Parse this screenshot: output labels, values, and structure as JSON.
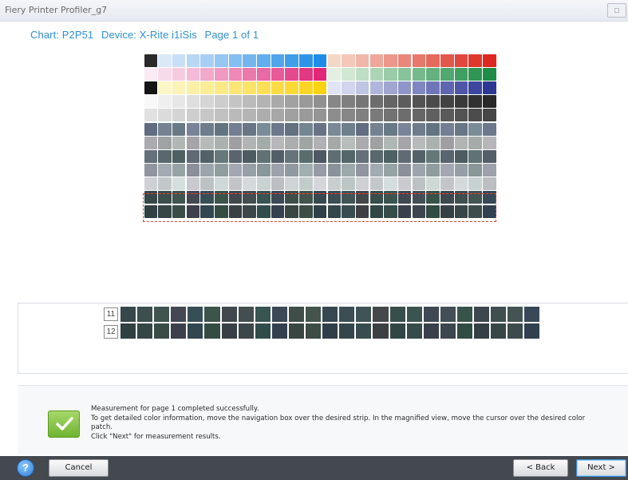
{
  "window": {
    "title": "Fiery Printer Profiler_g7",
    "control_glyph": "□"
  },
  "header": {
    "chart": "Chart: P2P51",
    "device": "Device: X-Rite i1iSis",
    "page": "Page 1 of 1"
  },
  "magnified": {
    "rows": [
      {
        "label": "11"
      },
      {
        "label": "12"
      }
    ]
  },
  "message": {
    "lines": [
      "Measurement for page 1 completed successfully.",
      "To get detailed color information, move the navigation box over the desired strip. In the magnified view, move the cursor over the desired color",
      "patch.",
      "Click \"Next\" for measurement results."
    ]
  },
  "buttons": {
    "help": "?",
    "cancel": "Cancel",
    "back": "< Back",
    "next": "Next >"
  },
  "colors": {
    "accent": "#2f8fd2",
    "bottom_bar": "#44484f",
    "nav_box": "#e0463a",
    "check_green": "#6fb432"
  }
}
